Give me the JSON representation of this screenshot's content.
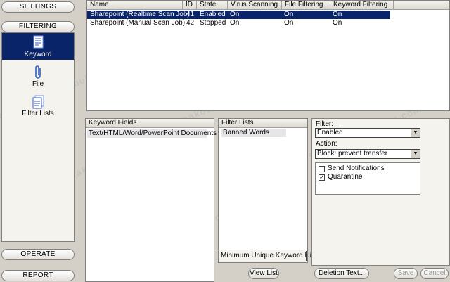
{
  "nav": {
    "settings": "SETTINGS",
    "filtering": "FILTERING",
    "operate": "OPERATE",
    "report": "REPORT",
    "items": [
      {
        "label": "Keyword",
        "icon": "keyword-document-icon"
      },
      {
        "label": "File",
        "icon": "paperclip-icon"
      },
      {
        "label": "Filter Lists",
        "icon": "filter-lists-icon"
      }
    ]
  },
  "jobs": {
    "columns": [
      "Name",
      "ID",
      "State",
      "Virus Scanning",
      "File Filtering",
      "Keyword Filtering"
    ],
    "rows": [
      {
        "name": "Sharepoint (Realtime Scan Job)",
        "id": "41",
        "state": "Enabled",
        "virus": "On",
        "file": "On",
        "keyword": "On"
      },
      {
        "name": "Sharepoint (Manual Scan Job)",
        "id": "42",
        "state": "Stopped",
        "virus": "On",
        "file": "On",
        "keyword": "On"
      }
    ]
  },
  "keyword_fields": {
    "header": "Keyword Fields",
    "items": [
      "Text/HTML/Word/PowerPoint Documents"
    ]
  },
  "filter_lists": {
    "header": "Filter Lists",
    "items": [
      "Banned Words"
    ],
    "min_hits_label": "Minimum Unique Keyword Hits:",
    "min_hits_value": "",
    "view_list": "View List"
  },
  "filter_settings": {
    "filter_label": "Filter:",
    "filter_value": "Enabled",
    "action_label": "Action:",
    "action_value": "Block: prevent transfer",
    "send_notifications": "Send Notifications",
    "quarantine": "Quarantine",
    "deletion_text": "Deletion Text...",
    "save": "Save",
    "cancel": "Cancel"
  },
  "watermark": "www.serhadmakbuloglu.com.tr"
}
